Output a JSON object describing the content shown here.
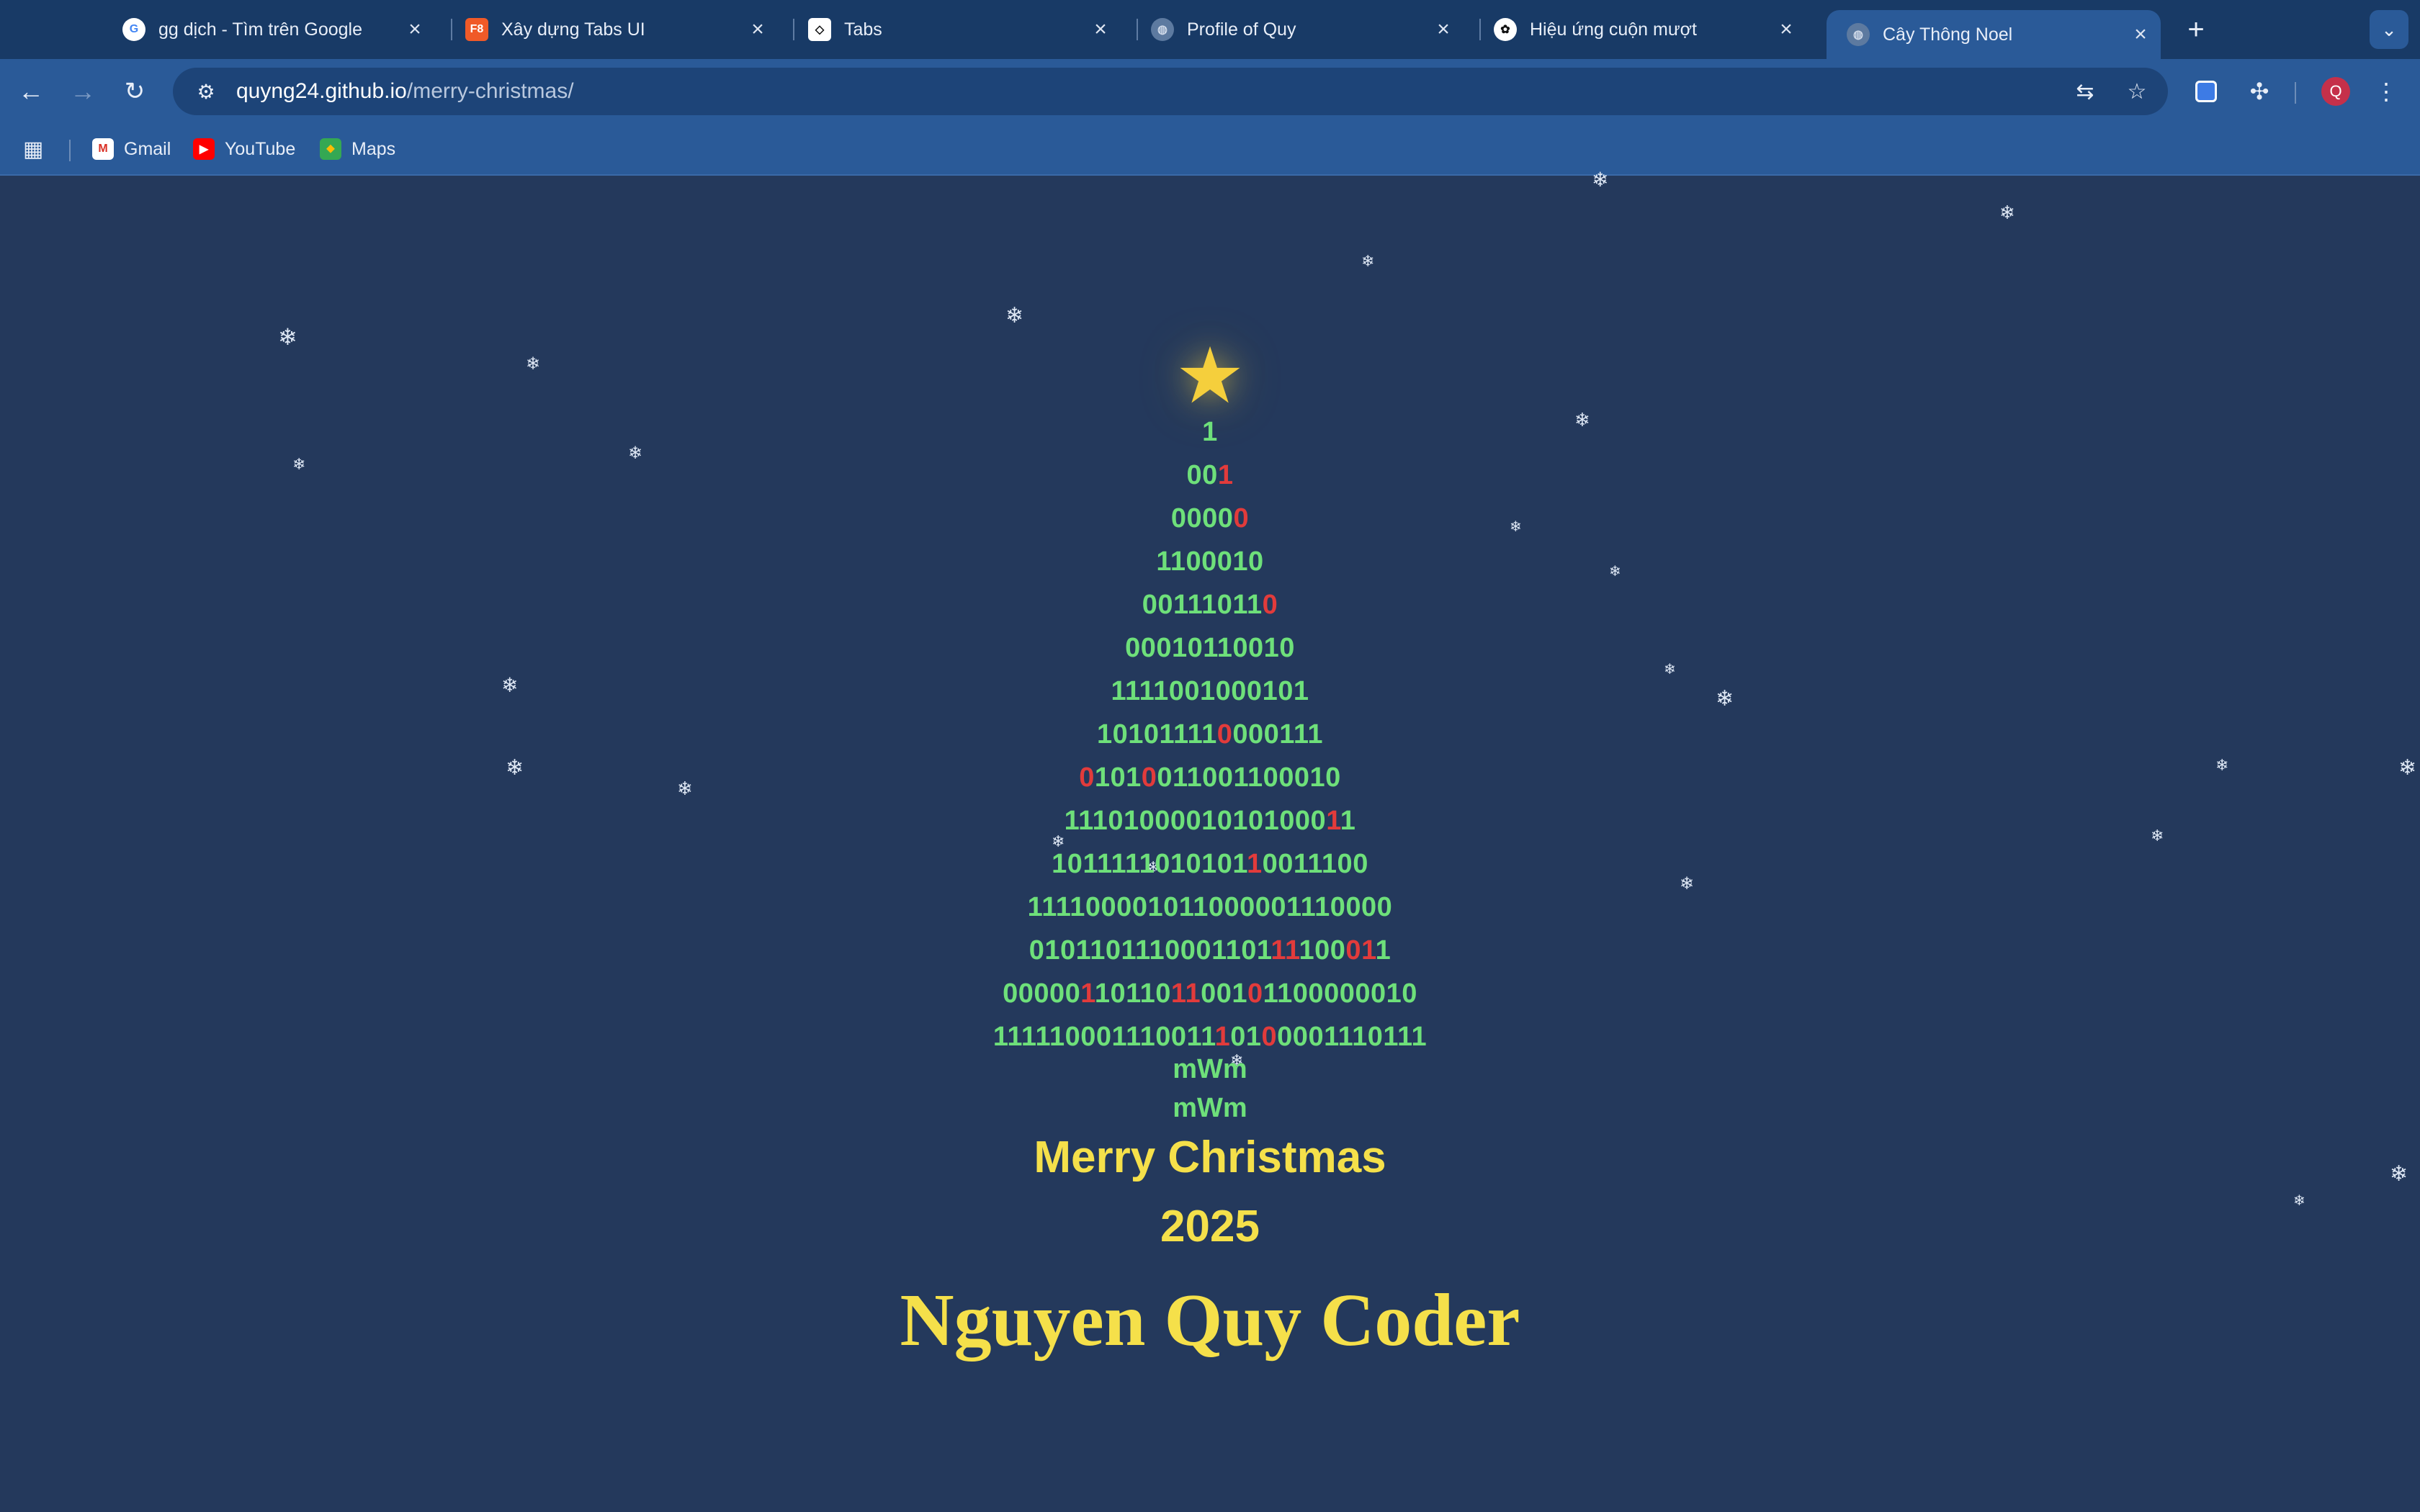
{
  "browser": {
    "tabs": [
      {
        "title": "gg dịch - Tìm trên Google",
        "favicon": "google-icon",
        "active": false
      },
      {
        "title": "Xây dựng Tabs UI",
        "favicon": "f8-icon",
        "active": false
      },
      {
        "title": "Tabs",
        "favicon": "codepen-icon",
        "active": false
      },
      {
        "title": "Profile of Quy",
        "favicon": "globe-icon",
        "active": false
      },
      {
        "title": "Hiệu ứng cuộn mượt",
        "favicon": "openai-icon",
        "active": false
      },
      {
        "title": "Cây Thông Noel",
        "favicon": "globe-icon",
        "active": true
      }
    ],
    "url_host": "quyng24.github.io",
    "url_path": "/merry-christmas/",
    "avatar_letter": "Q",
    "bookmarks": [
      {
        "label": "Gmail",
        "icon": "gmail-icon"
      },
      {
        "label": "YouTube",
        "icon": "youtube-icon"
      },
      {
        "label": "Maps",
        "icon": "maps-icon"
      }
    ]
  },
  "page": {
    "star": "★",
    "snowflake_glyph": "❄",
    "tree_rows": [
      [
        [
          "1",
          "g"
        ]
      ],
      [
        [
          "00",
          "g"
        ],
        [
          "1",
          "r"
        ]
      ],
      [
        [
          "0000",
          "g"
        ],
        [
          "0",
          "r"
        ]
      ],
      [
        [
          "1100010",
          "g"
        ]
      ],
      [
        [
          "0011101",
          "g"
        ],
        [
          "1",
          "g"
        ],
        [
          "0",
          "r"
        ]
      ],
      [
        [
          "00010110010",
          "g"
        ]
      ],
      [
        [
          "1111001000101",
          "g"
        ]
      ],
      [
        [
          "10101111",
          "g"
        ],
        [
          "0",
          "r"
        ],
        [
          "000111",
          "g"
        ]
      ],
      [
        [
          "0",
          "r"
        ],
        [
          "101",
          "g"
        ],
        [
          "0",
          "r"
        ],
        [
          "011001100010",
          "g"
        ]
      ],
      [
        [
          "11101000010101000",
          "g"
        ],
        [
          "1",
          "r"
        ],
        [
          "1",
          "g"
        ]
      ],
      [
        [
          "1011111010101",
          "g"
        ],
        [
          "1",
          "r"
        ],
        [
          "0011100",
          "g"
        ]
      ],
      [
        [
          "111100001011000001110000",
          "g"
        ]
      ],
      [
        [
          "0101101110001101",
          "g"
        ],
        [
          "1",
          "r"
        ],
        [
          "1",
          "r"
        ],
        [
          "100",
          "g"
        ],
        [
          "0",
          "r"
        ],
        [
          "1",
          "r"
        ],
        [
          "1",
          "g"
        ]
      ],
      [
        [
          "00000",
          "g"
        ],
        [
          "1",
          "r"
        ],
        [
          "10110",
          "g"
        ],
        [
          "11",
          "r"
        ],
        [
          "001",
          "g"
        ],
        [
          "0",
          "r"
        ],
        [
          "1100000010",
          "g"
        ]
      ],
      [
        [
          "11111000111001",
          "g"
        ],
        [
          "1",
          "g"
        ],
        [
          "1",
          "r"
        ],
        [
          "01",
          "g"
        ],
        [
          "0",
          "r"
        ],
        [
          "0001110111",
          "g"
        ]
      ]
    ],
    "trunk": [
      "mWm",
      "mWm"
    ],
    "greeting": "Merry Christmas",
    "year": "2025",
    "author": "Nguyen Quy Coder"
  }
}
